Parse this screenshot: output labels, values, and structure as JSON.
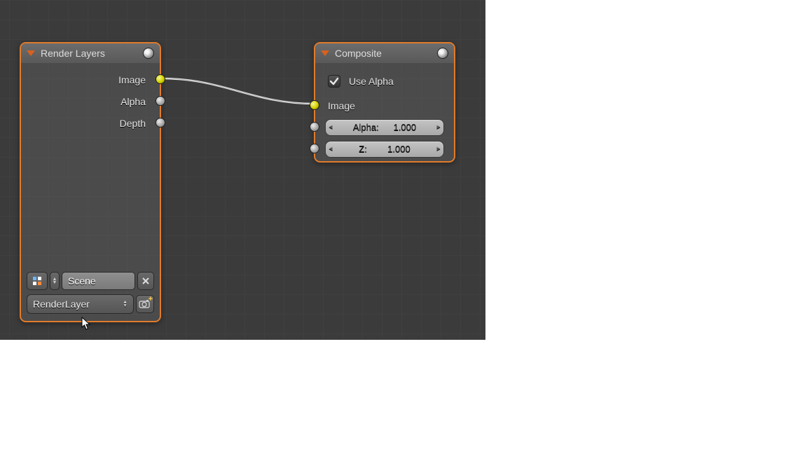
{
  "nodes": {
    "renderLayers": {
      "title": "Render Layers",
      "outputs": [
        "Image",
        "Alpha",
        "Depth"
      ],
      "scene_field": "Scene",
      "layer_select": "RenderLayer"
    },
    "composite": {
      "title": "Composite",
      "use_alpha_label": "Use Alpha",
      "use_alpha_checked": true,
      "inputs": {
        "image_label": "Image",
        "alpha": {
          "label": "Alpha:",
          "value": "1.000"
        },
        "z": {
          "label": "Z:",
          "value": "1.000"
        }
      }
    }
  }
}
